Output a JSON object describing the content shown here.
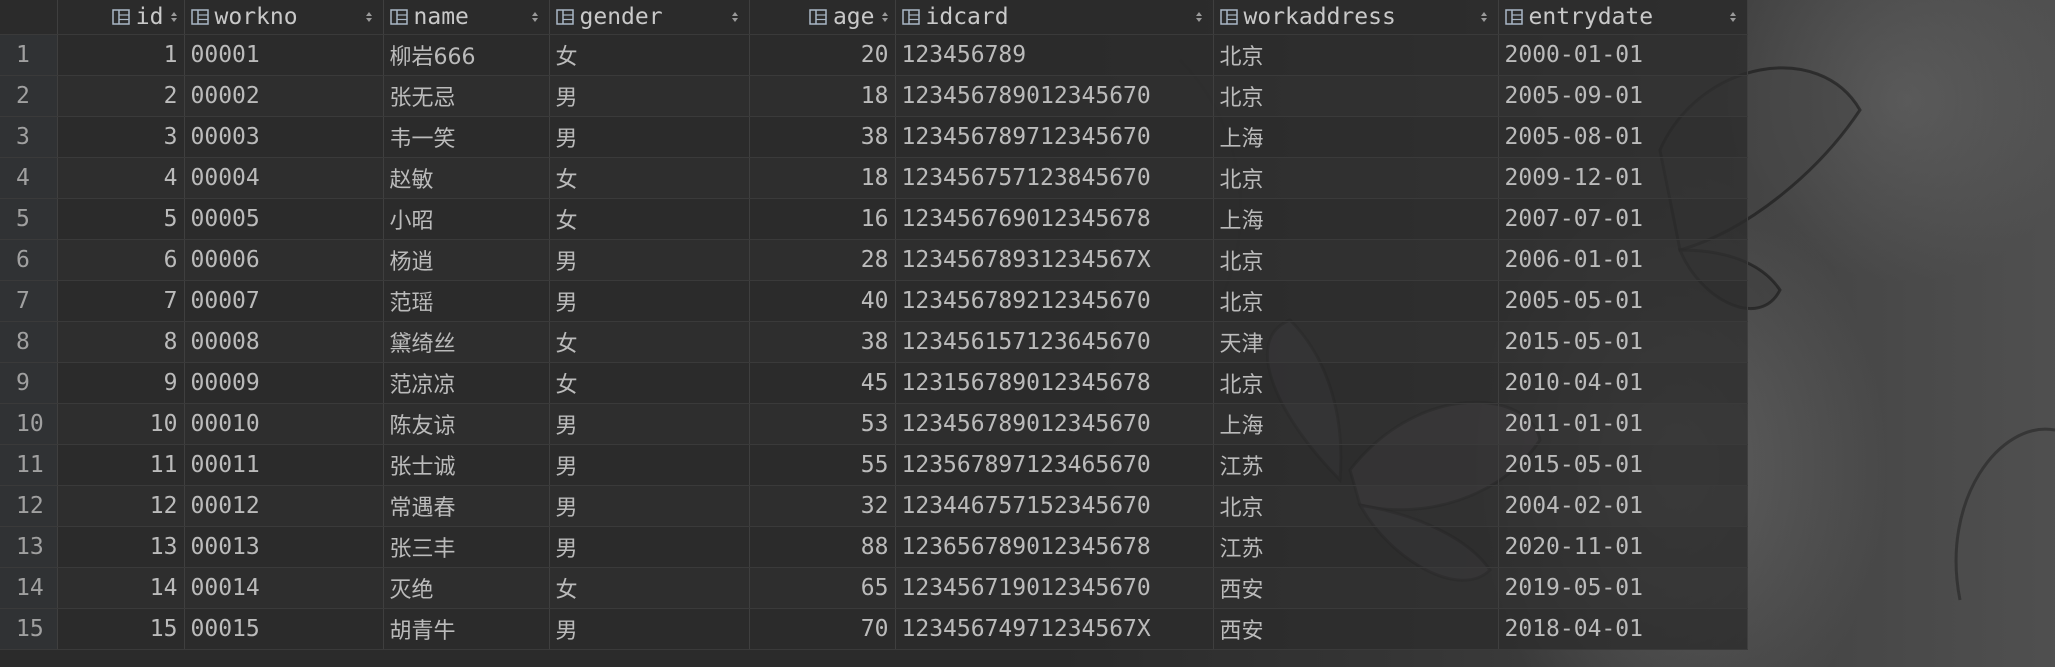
{
  "table": {
    "columns": [
      {
        "key": "id",
        "label": "id",
        "align": "right"
      },
      {
        "key": "workno",
        "label": "workno",
        "align": "left"
      },
      {
        "key": "name",
        "label": "name",
        "align": "left"
      },
      {
        "key": "gender",
        "label": "gender",
        "align": "left"
      },
      {
        "key": "age",
        "label": "age",
        "align": "right"
      },
      {
        "key": "idcard",
        "label": "idcard",
        "align": "left"
      },
      {
        "key": "workaddress",
        "label": "workaddress",
        "align": "left"
      },
      {
        "key": "entrydate",
        "label": "entrydate",
        "align": "left"
      }
    ],
    "rows": [
      {
        "row": "1",
        "id": "1",
        "workno": "00001",
        "name": "柳岩666",
        "gender": "女",
        "age": "20",
        "idcard": "123456789",
        "workaddress": "北京",
        "entrydate": "2000-01-01"
      },
      {
        "row": "2",
        "id": "2",
        "workno": "00002",
        "name": "张无忌",
        "gender": "男",
        "age": "18",
        "idcard": "123456789012345670",
        "workaddress": "北京",
        "entrydate": "2005-09-01"
      },
      {
        "row": "3",
        "id": "3",
        "workno": "00003",
        "name": "韦一笑",
        "gender": "男",
        "age": "38",
        "idcard": "123456789712345670",
        "workaddress": "上海",
        "entrydate": "2005-08-01"
      },
      {
        "row": "4",
        "id": "4",
        "workno": "00004",
        "name": "赵敏",
        "gender": "女",
        "age": "18",
        "idcard": "123456757123845670",
        "workaddress": "北京",
        "entrydate": "2009-12-01"
      },
      {
        "row": "5",
        "id": "5",
        "workno": "00005",
        "name": "小昭",
        "gender": "女",
        "age": "16",
        "idcard": "123456769012345678",
        "workaddress": "上海",
        "entrydate": "2007-07-01"
      },
      {
        "row": "6",
        "id": "6",
        "workno": "00006",
        "name": "杨逍",
        "gender": "男",
        "age": "28",
        "idcard": "12345678931234567X",
        "workaddress": "北京",
        "entrydate": "2006-01-01"
      },
      {
        "row": "7",
        "id": "7",
        "workno": "00007",
        "name": "范瑶",
        "gender": "男",
        "age": "40",
        "idcard": "123456789212345670",
        "workaddress": "北京",
        "entrydate": "2005-05-01"
      },
      {
        "row": "8",
        "id": "8",
        "workno": "00008",
        "name": "黛绮丝",
        "gender": "女",
        "age": "38",
        "idcard": "123456157123645670",
        "workaddress": "天津",
        "entrydate": "2015-05-01"
      },
      {
        "row": "9",
        "id": "9",
        "workno": "00009",
        "name": "范凉凉",
        "gender": "女",
        "age": "45",
        "idcard": "123156789012345678",
        "workaddress": "北京",
        "entrydate": "2010-04-01"
      },
      {
        "row": "10",
        "id": "10",
        "workno": "00010",
        "name": "陈友谅",
        "gender": "男",
        "age": "53",
        "idcard": "123456789012345670",
        "workaddress": "上海",
        "entrydate": "2011-01-01"
      },
      {
        "row": "11",
        "id": "11",
        "workno": "00011",
        "name": "张士诚",
        "gender": "男",
        "age": "55",
        "idcard": "123567897123465670",
        "workaddress": "江苏",
        "entrydate": "2015-05-01"
      },
      {
        "row": "12",
        "id": "12",
        "workno": "00012",
        "name": "常遇春",
        "gender": "男",
        "age": "32",
        "idcard": "123446757152345670",
        "workaddress": "北京",
        "entrydate": "2004-02-01"
      },
      {
        "row": "13",
        "id": "13",
        "workno": "00013",
        "name": "张三丰",
        "gender": "男",
        "age": "88",
        "idcard": "123656789012345678",
        "workaddress": "江苏",
        "entrydate": "2020-11-01"
      },
      {
        "row": "14",
        "id": "14",
        "workno": "00014",
        "name": "灭绝",
        "gender": "女",
        "age": "65",
        "idcard": "123456719012345670",
        "workaddress": "西安",
        "entrydate": "2019-05-01"
      },
      {
        "row": "15",
        "id": "15",
        "workno": "00015",
        "name": "胡青牛",
        "gender": "男",
        "age": "70",
        "idcard": "12345674971234567X",
        "workaddress": "西安",
        "entrydate": "2018-04-01"
      }
    ]
  },
  "icons": {
    "column": "column-icon",
    "sort": "sort-icon"
  },
  "colors": {
    "background": "#2b2b2b",
    "text": "#bbbbbb",
    "row_number": "#a0a0a0",
    "gridline": "#3f3f3f"
  }
}
